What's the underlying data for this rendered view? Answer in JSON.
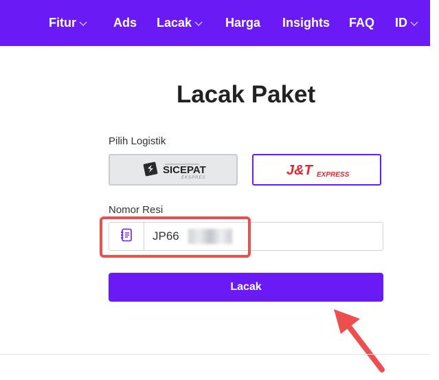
{
  "nav": {
    "items": [
      {
        "label": "Fitur",
        "dropdown": true
      },
      {
        "label": "Ads",
        "dropdown": false
      },
      {
        "label": "Lacak",
        "dropdown": true
      },
      {
        "label": "Harga",
        "dropdown": false
      },
      {
        "label": "Insights",
        "dropdown": false
      },
      {
        "label": "FAQ",
        "dropdown": false
      },
      {
        "label": "ID",
        "dropdown": true
      }
    ]
  },
  "page": {
    "title": "Lacak Paket"
  },
  "logistics": {
    "label": "Pilih Logistik",
    "options": [
      {
        "name": "SiCepat",
        "logo_text": "SICEPAT",
        "logo_sub": "EKSPRES",
        "selected": false
      },
      {
        "name": "J&T Express",
        "logo_text": "J&T",
        "logo_sub": "EXPRESS",
        "selected": true
      }
    ]
  },
  "resi": {
    "label": "Nomor Resi",
    "value": "JP66",
    "icon": "notebook-icon"
  },
  "submit": {
    "label": "Lacak"
  },
  "colors": {
    "brand": "#6a1bf5",
    "annotation": "#ef4e4e",
    "jt_red": "#e3262d"
  }
}
